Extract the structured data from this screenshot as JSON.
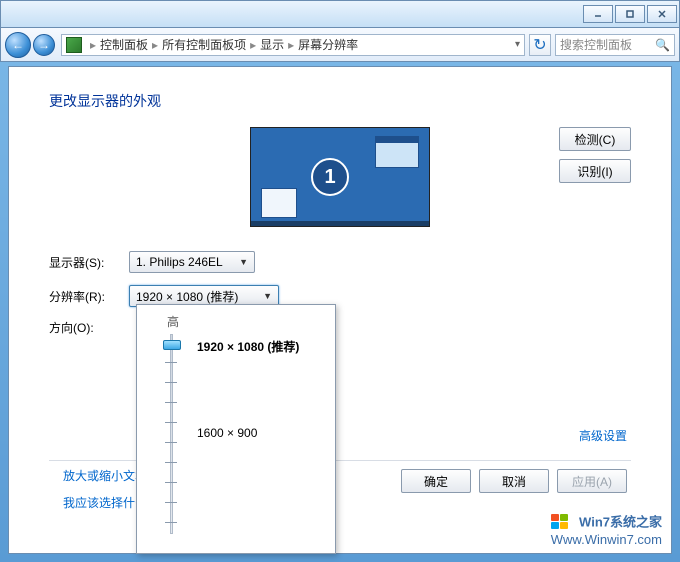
{
  "titlebar": {},
  "breadcrumb": {
    "item1": "控制面板",
    "item2": "所有控制面板项",
    "item3": "显示",
    "item4": "屏幕分辨率"
  },
  "search": {
    "placeholder": "搜索控制面板"
  },
  "page": {
    "title": "更改显示器的外观"
  },
  "preview": {
    "monitor_number": "1"
  },
  "sidebuttons": {
    "detect": "检测(C)",
    "identify": "识别(I)"
  },
  "form": {
    "display_label": "显示器(S):",
    "display_value": "1. Philips 246EL",
    "resolution_label": "分辨率(R):",
    "resolution_value": "1920 × 1080 (推荐)",
    "orientation_label": "方向(O):"
  },
  "slider": {
    "high": "高",
    "option_top": "1920 × 1080 (推荐)",
    "option_mid": "1600 × 900"
  },
  "links": {
    "advanced": "高级设置",
    "help1": "放大或缩小文本",
    "help2": "我应该选择什么"
  },
  "buttons": {
    "ok": "确定",
    "cancel": "取消",
    "apply": "应用(A)"
  },
  "watermark": {
    "line1": "Win7系统之家",
    "line2": "Www.Winwin7.com"
  }
}
